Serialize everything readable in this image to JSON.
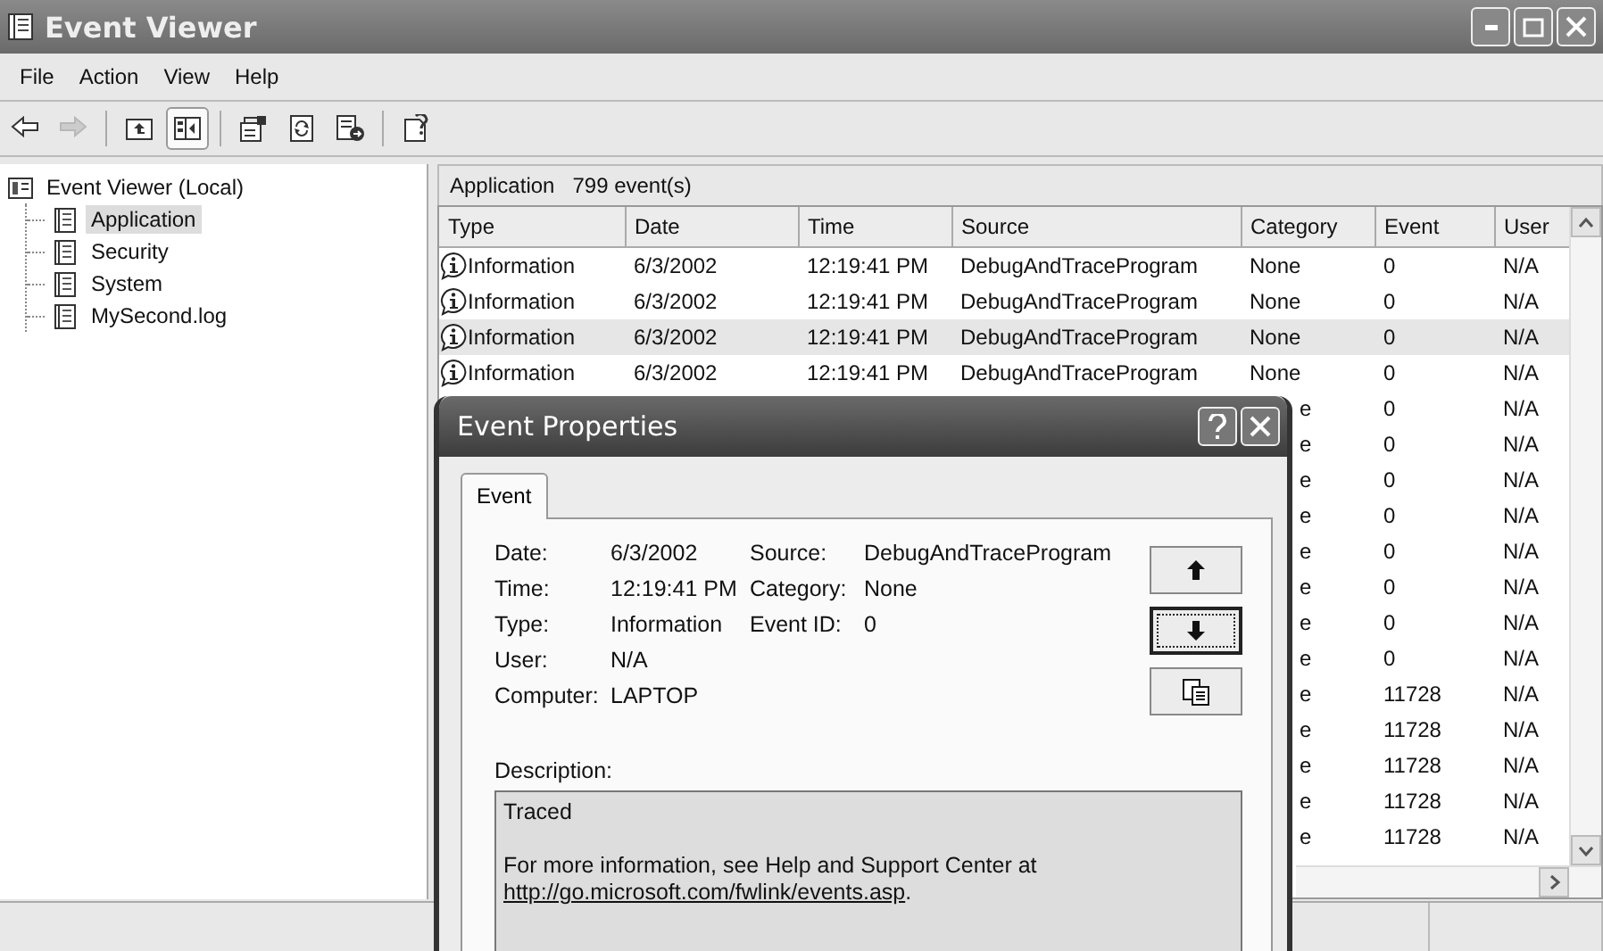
{
  "window": {
    "title": "Event Viewer"
  },
  "menu": [
    "File",
    "Action",
    "View",
    "Help"
  ],
  "toolbar": [
    {
      "kind": "back",
      "disabled": false,
      "pressed": false
    },
    {
      "kind": "forward",
      "disabled": true,
      "pressed": false
    },
    {
      "kind": "separator"
    },
    {
      "kind": "up",
      "disabled": false,
      "pressed": false
    },
    {
      "kind": "tree",
      "disabled": false,
      "pressed": true
    },
    {
      "kind": "separator"
    },
    {
      "kind": "properties",
      "disabled": false,
      "pressed": false
    },
    {
      "kind": "refresh",
      "disabled": false,
      "pressed": false
    },
    {
      "kind": "export",
      "disabled": false,
      "pressed": false
    },
    {
      "kind": "separator"
    },
    {
      "kind": "help",
      "disabled": false,
      "pressed": false
    }
  ],
  "tree": {
    "label": "Event Viewer (Local)",
    "children": [
      {
        "label": "Application",
        "selected": true
      },
      {
        "label": "Security",
        "selected": false
      },
      {
        "label": "System",
        "selected": false
      },
      {
        "label": "MySecond.log",
        "selected": false
      }
    ]
  },
  "list": {
    "title": "Application",
    "count": "799 event(s)",
    "columns": [
      "Type",
      "Date",
      "Time",
      "Source",
      "Category",
      "Event",
      "User"
    ],
    "rows": [
      {
        "type": "Information",
        "date": "6/3/2002",
        "time": "12:19:41 PM",
        "source": "DebugAndTraceProgram",
        "category": "None",
        "event": "0",
        "user": "N/A",
        "selected": false
      },
      {
        "type": "Information",
        "date": "6/3/2002",
        "time": "12:19:41 PM",
        "source": "DebugAndTraceProgram",
        "category": "None",
        "event": "0",
        "user": "N/A",
        "selected": false
      },
      {
        "type": "Information",
        "date": "6/3/2002",
        "time": "12:19:41 PM",
        "source": "DebugAndTraceProgram",
        "category": "None",
        "event": "0",
        "user": "N/A",
        "selected": true
      },
      {
        "type": "Information",
        "date": "6/3/2002",
        "time": "12:19:41 PM",
        "source": "DebugAndTraceProgram",
        "category": "None",
        "event": "0",
        "user": "N/A",
        "selected": false
      },
      {
        "category": "e",
        "event": "0",
        "user": "N/A",
        "selected": false
      },
      {
        "category": "e",
        "event": "0",
        "user": "N/A",
        "selected": false
      },
      {
        "category": "e",
        "event": "0",
        "user": "N/A",
        "selected": false
      },
      {
        "category": "e",
        "event": "0",
        "user": "N/A",
        "selected": false
      },
      {
        "category": "e",
        "event": "0",
        "user": "N/A",
        "selected": false
      },
      {
        "category": "e",
        "event": "0",
        "user": "N/A",
        "selected": false
      },
      {
        "category": "e",
        "event": "0",
        "user": "N/A",
        "selected": false
      },
      {
        "category": "e",
        "event": "0",
        "user": "N/A",
        "selected": false
      },
      {
        "category": "e",
        "event": "11728",
        "user": "N/A",
        "selected": false
      },
      {
        "category": "e",
        "event": "11728",
        "user": "N/A",
        "selected": false
      },
      {
        "category": "e",
        "event": "11728",
        "user": "N/A",
        "selected": false
      },
      {
        "category": "e",
        "event": "11728",
        "user": "N/A",
        "selected": false
      },
      {
        "category": "e",
        "event": "11728",
        "user": "N/A",
        "selected": false
      }
    ]
  },
  "dialog": {
    "title": "Event Properties",
    "tabs": [
      {
        "label": "Event",
        "selected": true
      }
    ],
    "left_fields": [
      {
        "label": "Date:",
        "value": "6/3/2002"
      },
      {
        "label": "Time:",
        "value": "12:19:41 PM"
      },
      {
        "label": "Type:",
        "value": "Information"
      },
      {
        "label": "User:",
        "value": "N/A"
      },
      {
        "label": "Computer:",
        "value": "LAPTOP"
      }
    ],
    "right_fields": [
      {
        "label": "Source:",
        "value": "DebugAndTraceProgram"
      },
      {
        "label": "Category:",
        "value": "None"
      },
      {
        "label": "Event ID:",
        "value": "0"
      }
    ],
    "buttons": [
      {
        "kind": "up",
        "focused": false
      },
      {
        "kind": "down",
        "focused": true
      },
      {
        "kind": "copy",
        "focused": false
      }
    ],
    "description": {
      "label": "Description:",
      "first": "Traced",
      "text": "For more information, see Help and Support Center at",
      "link": "http://go.microsoft.com/fwlink/events.asp",
      "after_link": "."
    }
  }
}
